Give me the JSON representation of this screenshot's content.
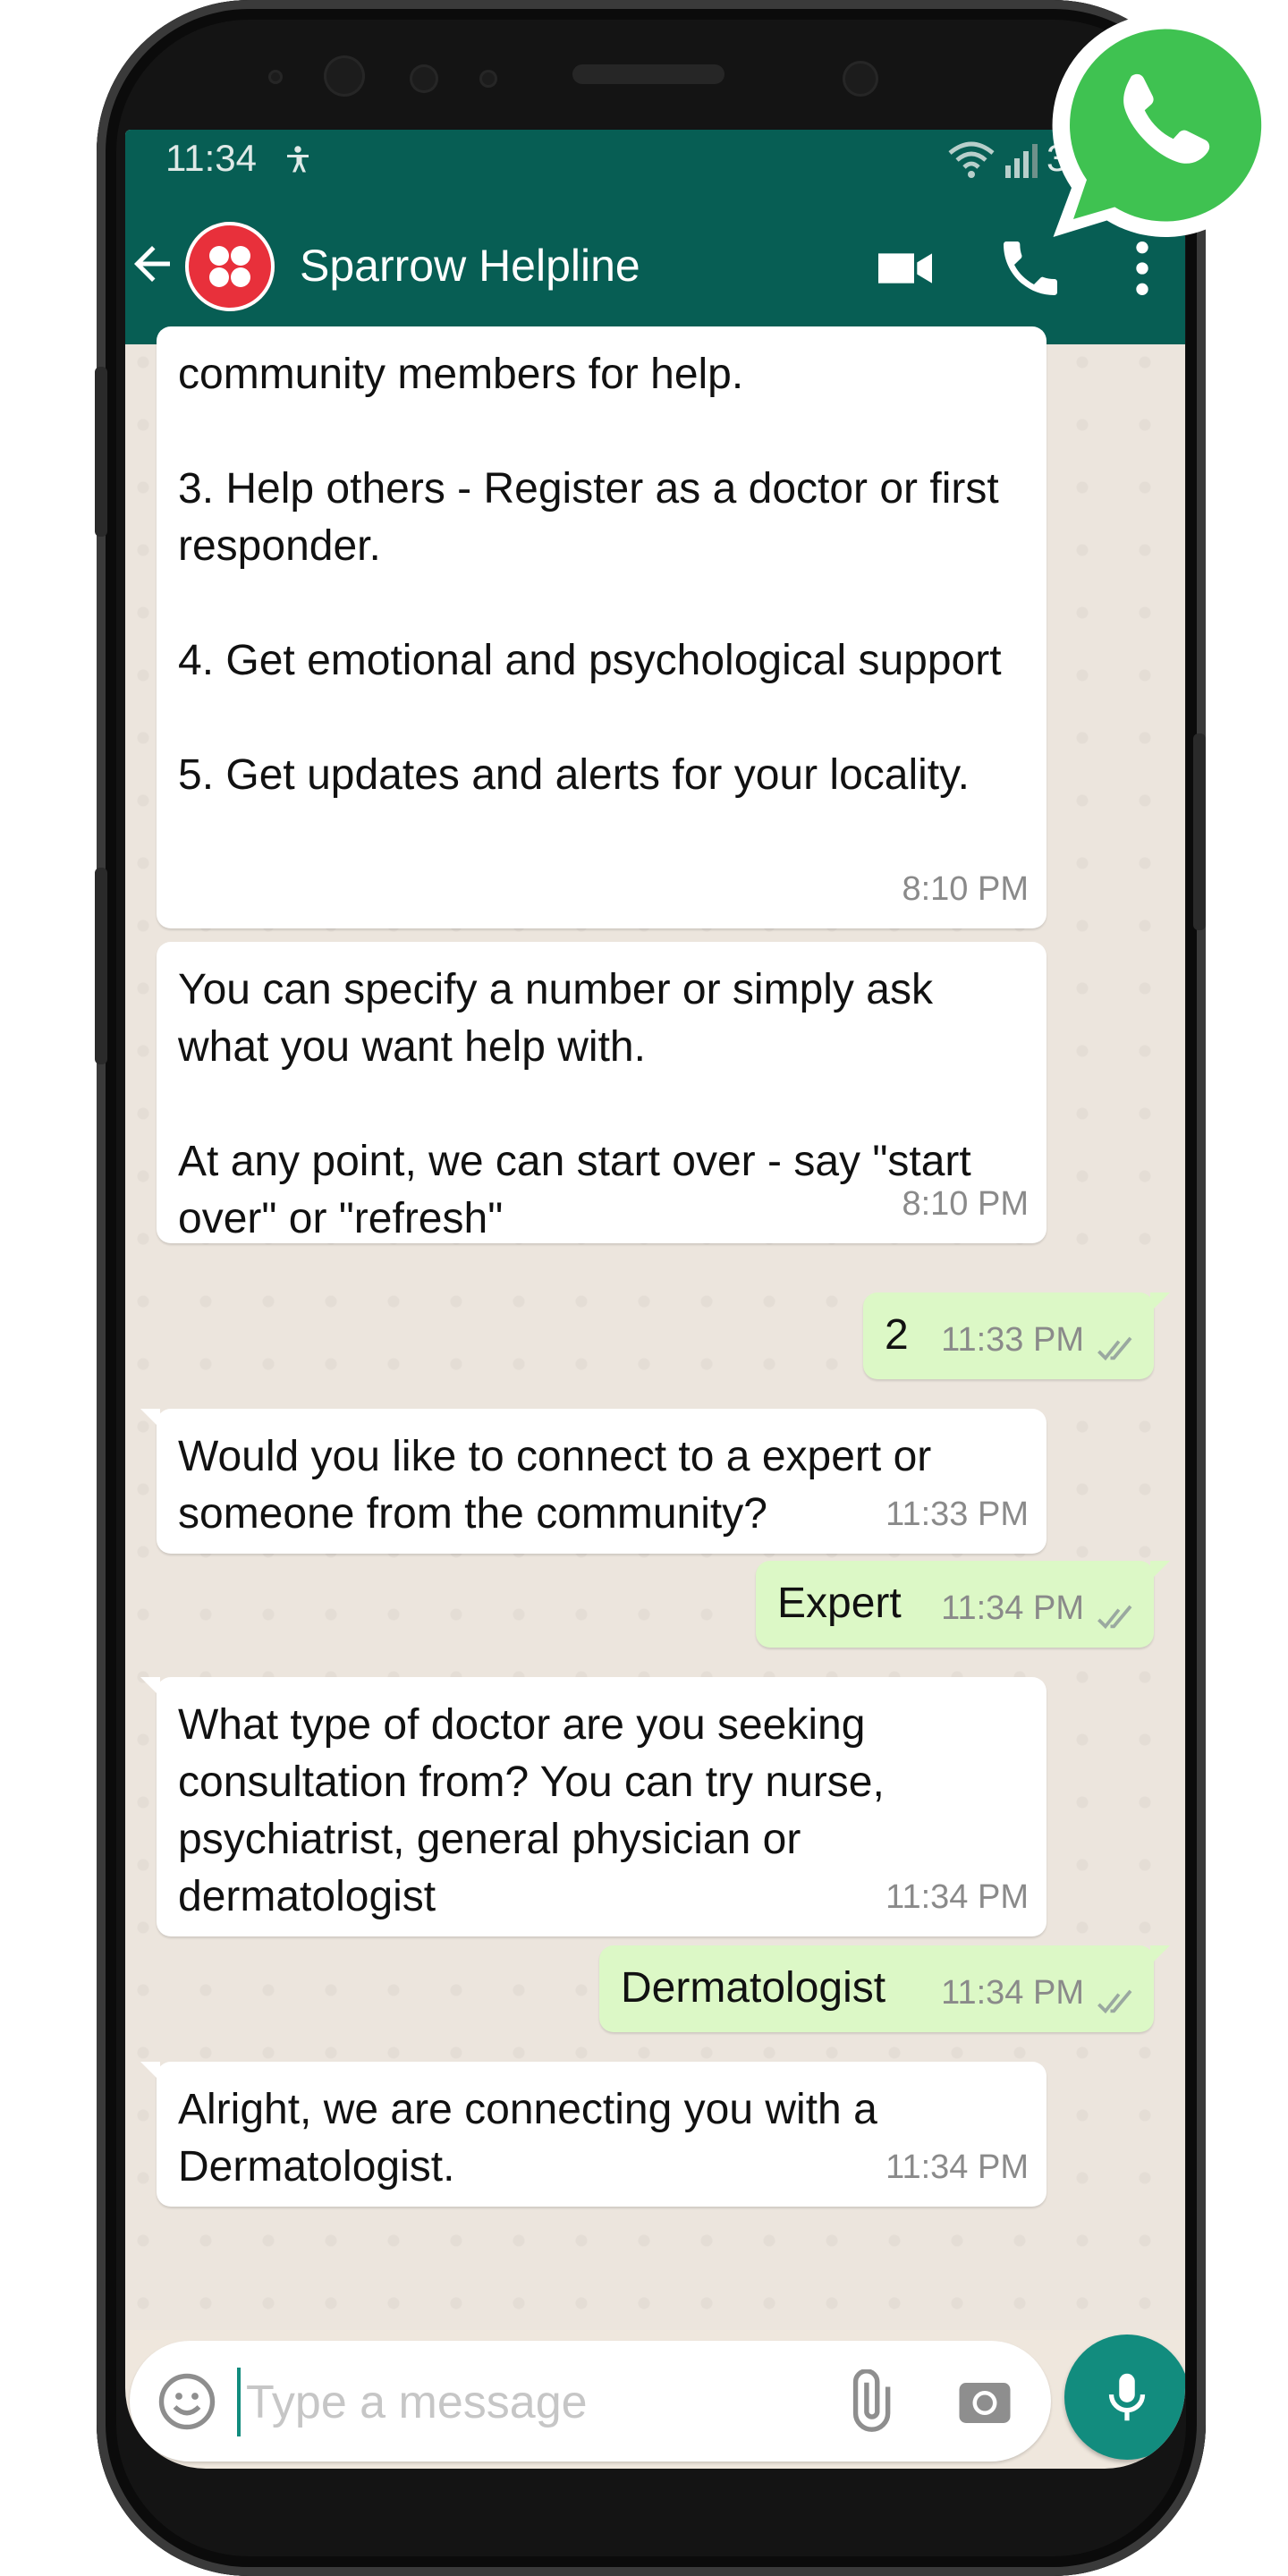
{
  "status_bar": {
    "time": "11:34",
    "battery_text": "3"
  },
  "header": {
    "title": "Sparrow Helpline"
  },
  "colors": {
    "header": "#075e54",
    "accent": "#128c7e",
    "outgoing_bubble": "#dcf8c6",
    "avatar": "#e8303b"
  },
  "messages": [
    {
      "direction": "in",
      "text": "community members for help.\n\n3. Help others - Register as a doctor or first responder.\n\n4. Get emotional and psychological support\n\n5. Get updates and alerts for your locality.",
      "time": "8:10 PM"
    },
    {
      "direction": "in",
      "text": "You can specify a number or simply ask what you want help with.\n\nAt any point, we can start over - say \"start over\" or \"refresh\"",
      "time": "8:10 PM"
    },
    {
      "direction": "out",
      "text": "2",
      "time": "11:33 PM"
    },
    {
      "direction": "in",
      "text": "Would you like to connect to a expert or someone from the community?",
      "time": "11:33 PM"
    },
    {
      "direction": "out",
      "text": "Expert",
      "time": "11:34 PM"
    },
    {
      "direction": "in",
      "text": "What type of doctor are you seeking consultation from? You can try nurse, psychiatrist, general physician or dermatologist",
      "time": "11:34 PM"
    },
    {
      "direction": "out",
      "text": "Dermatologist",
      "time": "11:34 PM"
    },
    {
      "direction": "in",
      "text": "Alright, we are connecting you with a Dermatologist.",
      "time": "11:34 PM"
    }
  ],
  "composer": {
    "placeholder": "Type a message"
  },
  "icons": {
    "header": [
      "back-arrow",
      "avatar",
      "video-call",
      "phone-call",
      "more-vertical"
    ],
    "composer": [
      "emoji",
      "attach-paperclip",
      "camera",
      "microphone"
    ],
    "nav": [
      "recent-apps",
      "home",
      "back"
    ],
    "overlay": "whatsapp-logo"
  }
}
